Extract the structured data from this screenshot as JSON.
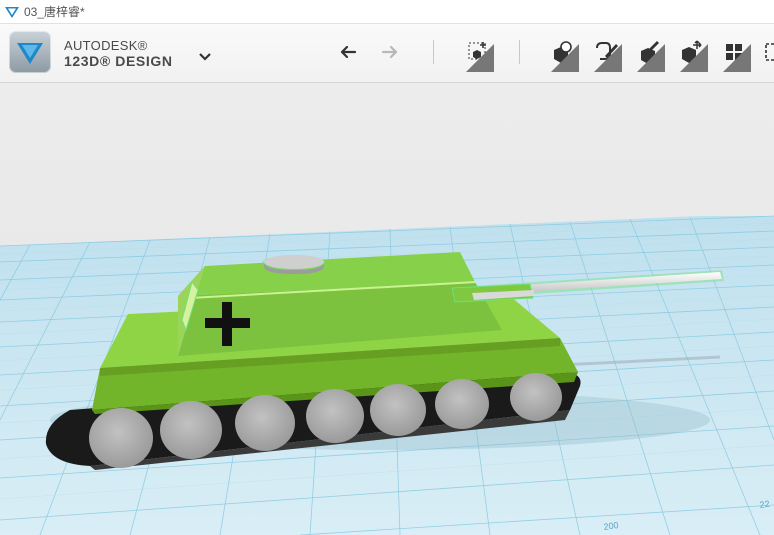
{
  "window": {
    "title": "03_唐梓睿*"
  },
  "brand": {
    "line1": "AUTODESK®",
    "line2": "123D® DESIGN"
  },
  "toolbar": {
    "icons": [
      "undo-icon",
      "redo-icon",
      "primitives-icon",
      "sketch-icon",
      "construct-icon",
      "modify-icon",
      "transform-icon",
      "pattern-icon"
    ]
  },
  "viewport": {
    "grid_label": "200",
    "grid_label_2": "22"
  },
  "colors": {
    "accent": "#1e88c8",
    "grid_bg": "#cfe7f1",
    "grid_line": "#7fc1da",
    "tank_green": "#7dc23a",
    "tank_dark": "#5f9e1e",
    "track": "#1c1c1c",
    "wheel": "#a9a9a9",
    "selection": "#6fe07a"
  }
}
